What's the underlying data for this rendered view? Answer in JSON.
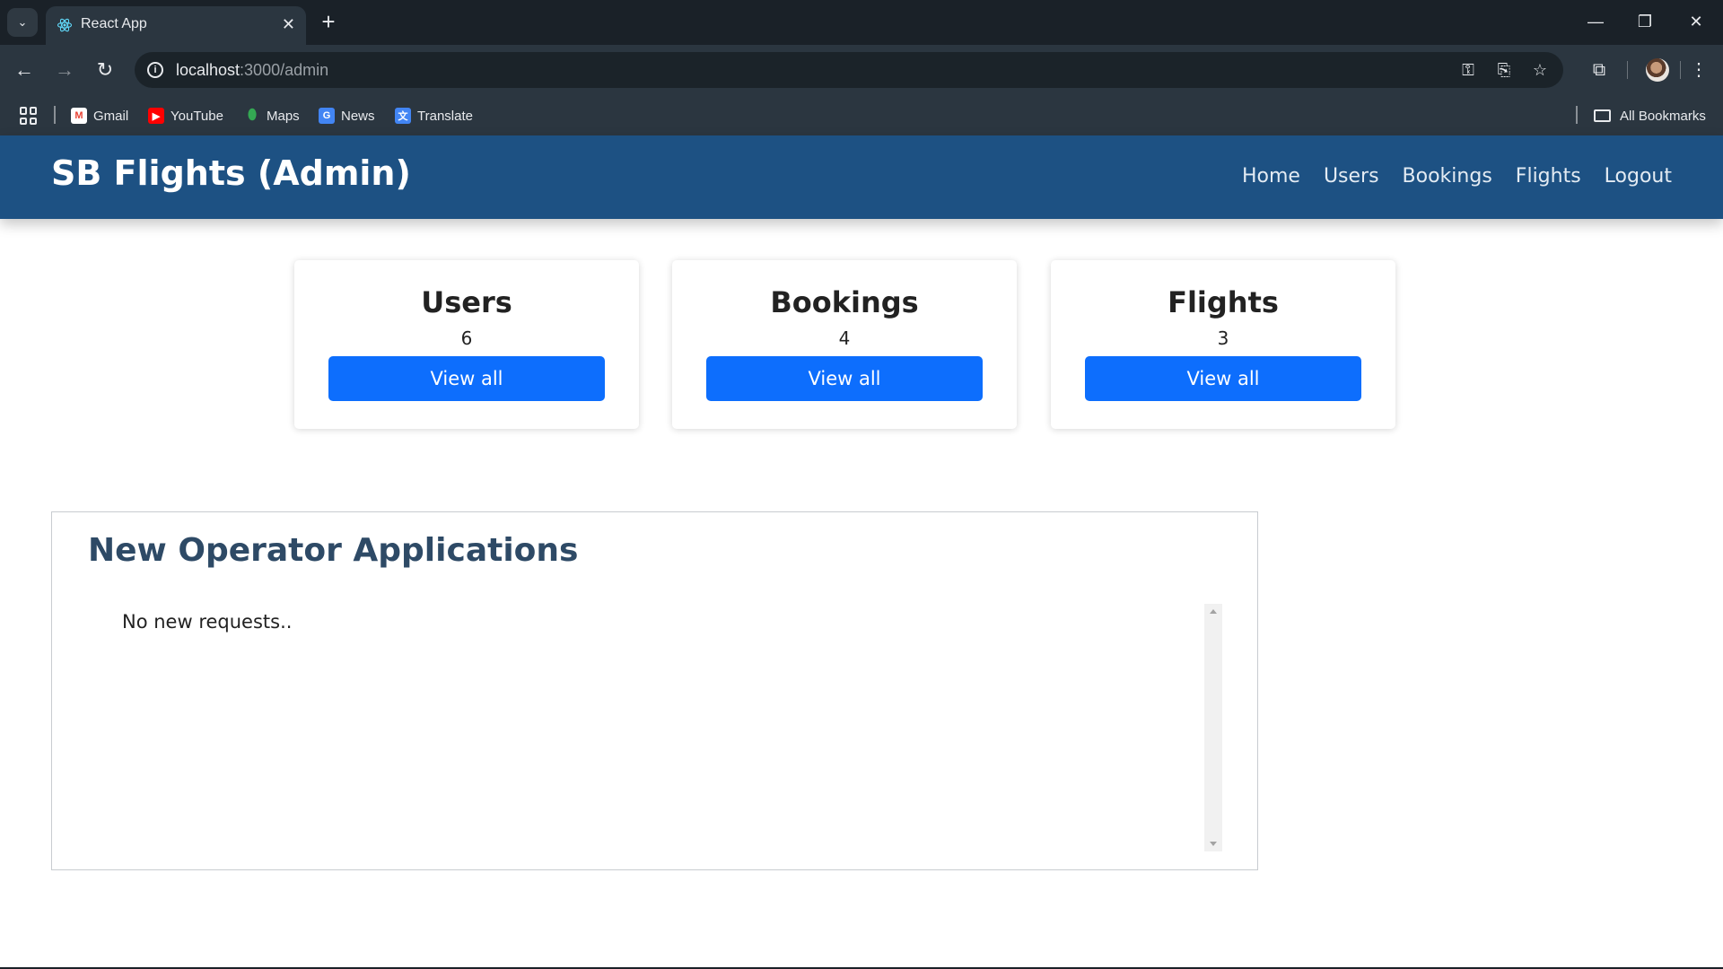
{
  "browser": {
    "tab_title": "React App",
    "url_host": "localhost",
    "url_path": ":3000/admin",
    "bookmarks": [
      {
        "label": "Gmail",
        "icon": "gmail-icon",
        "color": "#ea4335"
      },
      {
        "label": "YouTube",
        "icon": "youtube-icon",
        "color": "#ff0000"
      },
      {
        "label": "Maps",
        "icon": "maps-icon",
        "color": "#34a853"
      },
      {
        "label": "News",
        "icon": "news-icon",
        "color": "#4285f4"
      },
      {
        "label": "Translate",
        "icon": "translate-icon",
        "color": "#4285f4"
      }
    ],
    "all_bookmarks_label": "All Bookmarks"
  },
  "navbar": {
    "brand": "SB Flights (Admin)",
    "links": [
      "Home",
      "Users",
      "Bookings",
      "Flights",
      "Logout"
    ],
    "background": "#1d5183"
  },
  "cards": [
    {
      "title": "Users",
      "count": "6",
      "button": "View all"
    },
    {
      "title": "Bookings",
      "count": "4",
      "button": "View all"
    },
    {
      "title": "Flights",
      "count": "3",
      "button": "View all"
    }
  ],
  "applications": {
    "title": "New Operator Applications",
    "empty_text": "No new requests.."
  },
  "colors": {
    "primary_button": "#0d6efd",
    "heading": "#2e4a66"
  }
}
